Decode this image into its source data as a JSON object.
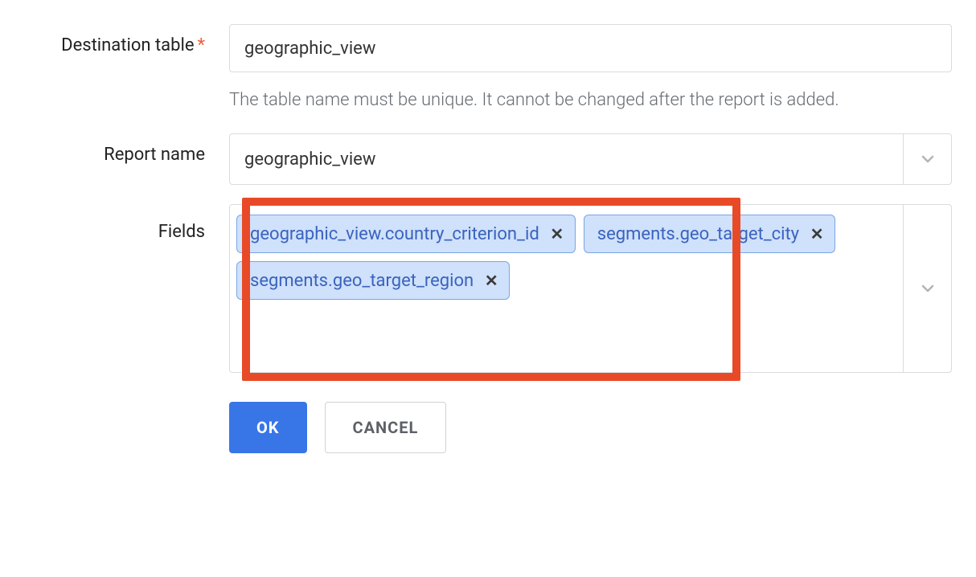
{
  "destination_table": {
    "label": "Destination table",
    "value": "geographic_view",
    "helper": "The table name must be unique. It cannot be changed after the report is added."
  },
  "report_name": {
    "label": "Report name",
    "value": "geographic_view"
  },
  "fields": {
    "label": "Fields",
    "pills": [
      "geographic_view.country_criterion_id",
      "segments.geo_target_city",
      "segments.geo_target_region"
    ]
  },
  "buttons": {
    "ok": "OK",
    "cancel": "CANCEL"
  }
}
